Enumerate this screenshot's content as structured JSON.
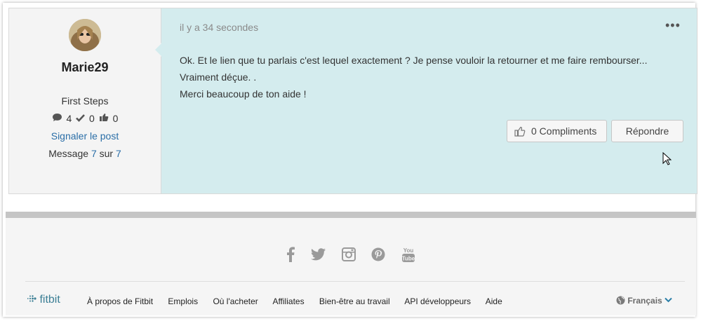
{
  "post": {
    "author": {
      "username": "Marie29",
      "rank": "First Steps",
      "stats": {
        "messages": "4",
        "solutions": "0",
        "kudos": "0"
      },
      "report_label": "Signaler le post",
      "message_prefix": "Message",
      "message_index": "7",
      "message_sep": "sur",
      "message_total": "7"
    },
    "timestamp": "il y a 34 secondes",
    "menu_label": "•••",
    "body_lines": [
      "Ok. Et le lien que tu parlais c'est lequel exactement ? Je pense vouloir la retourner et me faire rembourser...",
      "Vraiment déçue. .",
      "Merci beaucoup de ton aide !"
    ],
    "kudos_label": "0 Compliments",
    "reply_label": "Répondre"
  },
  "footer": {
    "social_icons": [
      "facebook-icon",
      "twitter-icon",
      "instagram-icon",
      "pinterest-icon",
      "youtube-icon"
    ],
    "logo_text": "fitbit",
    "links": [
      "À propos de Fitbit",
      "Emplois",
      "Où l'acheter",
      "Affiliates",
      "Bien-être au travail",
      "API développeurs",
      "Aide"
    ],
    "language": "Français"
  },
  "colors": {
    "bubble": "#d4ecee",
    "link": "#2a6ea7",
    "brand": "#3c7f95"
  }
}
